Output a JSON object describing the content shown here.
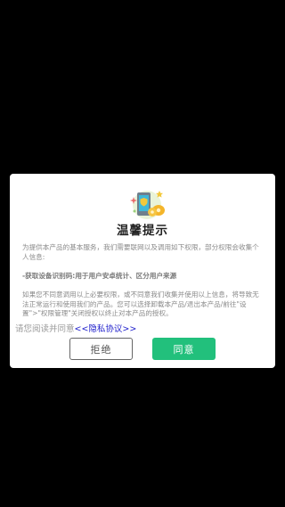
{
  "dialog": {
    "title": "温馨提示",
    "intro": "为提供本产品的基本服务，我们需要联网以及调用如下权限，部分权限会收集个人信息:",
    "permission_item": "-获取设备识别码:用于用户安卓统计、区分用户来源",
    "notice": "如果您不同意调用以上必要权限，或不同意我们收集并使用以上信息，将导致无法正常运行和使用我们的产品。您可以选择卸载本产品/退出本产品/前往\"设置\">\"权限管理\"关闭授权以终止对本产品的授权。",
    "agree_prefix": "请您阅读并同意",
    "privacy_link": "<<隐私协议>>",
    "reject_label": "拒绝",
    "accept_label": "同意"
  },
  "colors": {
    "accent": "#22c07c",
    "link": "#2222cc",
    "overlay": "#000000"
  },
  "icons": {
    "illustration": "phone-shield-illustration"
  }
}
